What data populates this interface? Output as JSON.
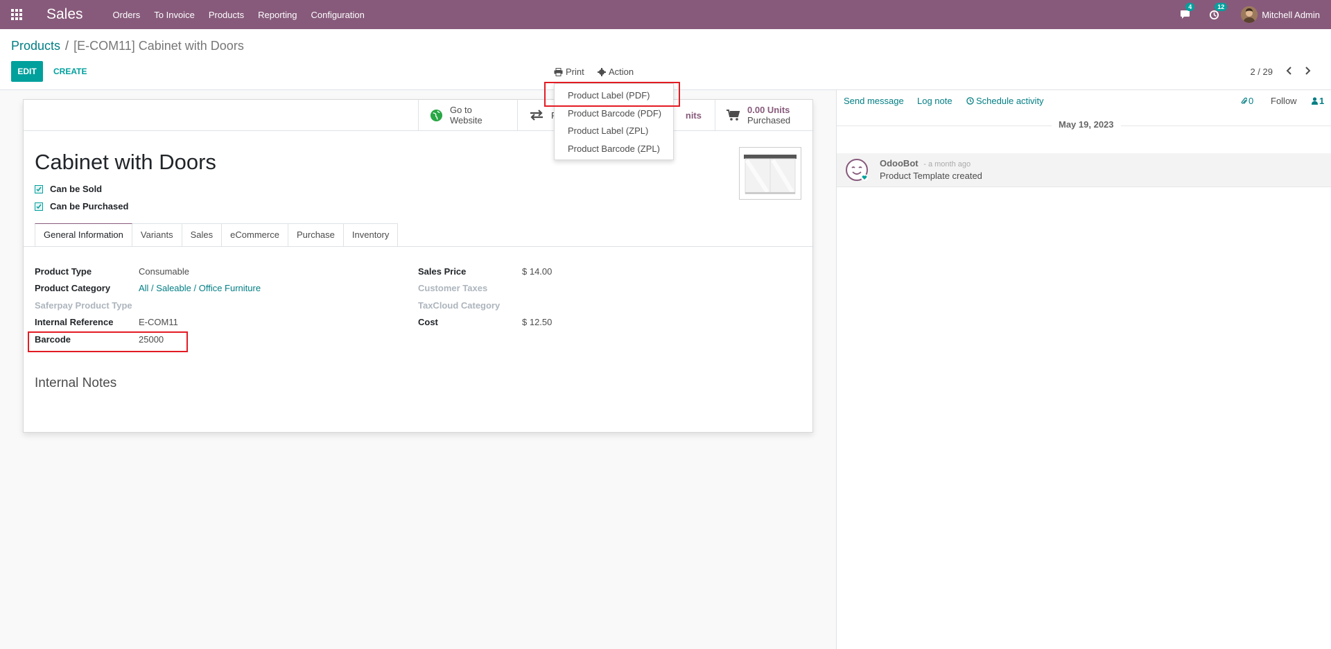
{
  "navbar": {
    "app_name": "Sales",
    "menu": [
      "Orders",
      "To Invoice",
      "Products",
      "Reporting",
      "Configuration"
    ],
    "messages_count": "4",
    "activities_count": "12",
    "user_name": "Mitchell Admin"
  },
  "breadcrumb": {
    "parent": "Products",
    "separator": "/",
    "current": "[E-COM11] Cabinet with Doors"
  },
  "toolbar": {
    "edit_label": "EDIT",
    "create_label": "CREATE",
    "print_label": "Print",
    "action_label": "Action",
    "pager": "2 / 29"
  },
  "print_menu": {
    "items": [
      "Product Label (PDF)",
      "Product Barcode (PDF)",
      "Product Label (ZPL)",
      "Product Barcode (ZPL)"
    ]
  },
  "stat_buttons": {
    "website_line1": "Go to",
    "website_line2": "Website",
    "moves_partial": "F",
    "units_partial": "nits",
    "purchased_value": "0.00 Units",
    "purchased_label": "Purchased"
  },
  "product": {
    "name": "Cabinet with Doors",
    "can_be_sold": "Can be Sold",
    "can_be_purchased": "Can be Purchased"
  },
  "tabs": [
    "General Information",
    "Variants",
    "Sales",
    "eCommerce",
    "Purchase",
    "Inventory"
  ],
  "fields_left": [
    {
      "label": "Product Type",
      "value": "Consumable"
    },
    {
      "label": "Product Category",
      "value": "All / Saleable / Office Furniture"
    },
    {
      "label": "Saferpay Product Type",
      "value": ""
    },
    {
      "label": "Internal Reference",
      "value": "E-COM11"
    },
    {
      "label": "Barcode",
      "value": "25000"
    }
  ],
  "fields_right": [
    {
      "label": "Sales Price",
      "value": "$ 14.00"
    },
    {
      "label": "Customer Taxes",
      "value": ""
    },
    {
      "label": "TaxCloud Category",
      "value": ""
    },
    {
      "label": "Cost",
      "value": "$ 12.50"
    }
  ],
  "notes_title": "Internal Notes",
  "chatter": {
    "send_message": "Send message",
    "log_note": "Log note",
    "schedule_activity": "Schedule activity",
    "attachments_count": "0",
    "follow": "Follow",
    "followers_count": "1",
    "date": "May 19, 2023",
    "message": {
      "author": "OdooBot",
      "time": "- a month ago",
      "body": "Product Template created"
    }
  },
  "colors": {
    "brand": "#875a7b",
    "accent": "#00a09d",
    "link": "#017e84",
    "highlight": "#e31b23"
  }
}
